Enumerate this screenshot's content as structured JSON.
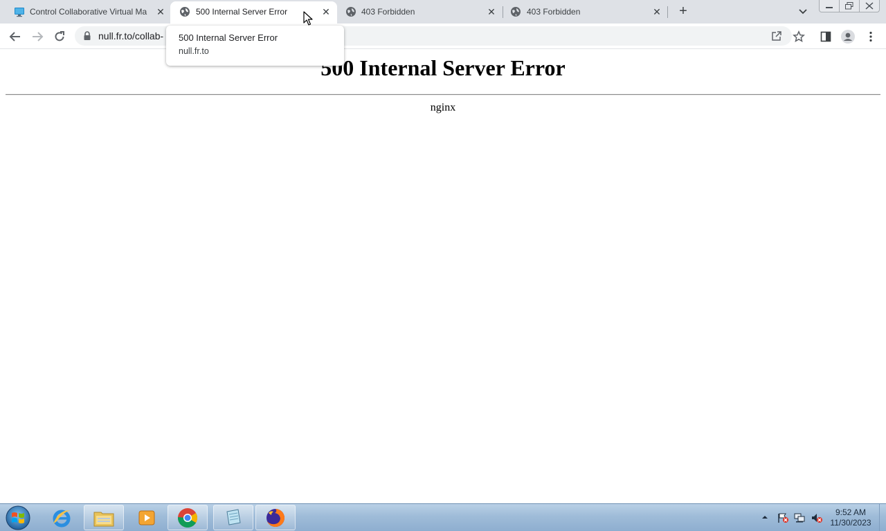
{
  "browser": {
    "tabs": [
      {
        "title": "Control Collaborative Virtual Ma",
        "favicon": "monitor-icon",
        "active": false
      },
      {
        "title": "500 Internal Server Error",
        "favicon": "globe-icon",
        "active": true
      },
      {
        "title": "403 Forbidden",
        "favicon": "globe-icon",
        "active": false
      },
      {
        "title": "403 Forbidden",
        "favicon": "globe-icon",
        "active": false
      }
    ],
    "new_tab_label": "+",
    "close_glyph": "✕",
    "address_bar": {
      "url": "null.fr.to/collab-"
    },
    "hover_card": {
      "title": "500 Internal Server Error",
      "domain": "null.fr.to"
    }
  },
  "page": {
    "heading": "500 Internal Server Error",
    "server": "nginx"
  },
  "taskbar": {
    "apps": [
      "internet-explorer",
      "file-explorer",
      "media-player",
      "chrome",
      "notepad",
      "firefox"
    ],
    "clock": {
      "time": "9:52 AM",
      "date": "11/30/2023"
    }
  },
  "colors": {
    "tabstrip_bg": "#dee1e6",
    "omnibox_bg": "#f1f3f4",
    "taskbar_bg": "#9fbcd8"
  }
}
